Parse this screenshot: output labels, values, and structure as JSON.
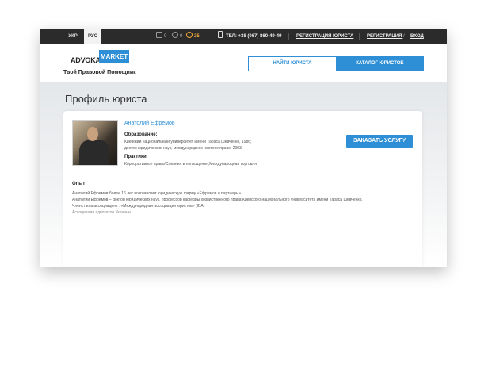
{
  "topbar": {
    "lang_ukr": "УКР",
    "lang_rus": "РУС",
    "counter_messages": "0",
    "counter_questions": "0",
    "counter_notifications": "25",
    "phone": "ТЕЛ: +38 (067) 860-49-49",
    "register_lawyer": "РЕГИСТРАЦИЯ ЮРИСТА",
    "register": "РЕГИСТРАЦИЯ",
    "slash": "/",
    "login": "ВХОД"
  },
  "header": {
    "logo_text": "ADVOKAT",
    "logo_box": "MARKET",
    "logo_tagline": "Твой Правовой Помощник",
    "btn_find": "НАЙТИ ЮРИСТА",
    "btn_catalog": "КАТАЛОГ ЮРИСТОВ"
  },
  "page": {
    "title": "Профиль юриста"
  },
  "profile": {
    "name": "Анатолий Ефремов",
    "education_label": "Образование:",
    "education_line1": "Киевский национальный университет имени Тараса Шевченко, 1986;",
    "education_line2": "доктор юридических наук, международное частное право, 2003",
    "practice_label": "Практики:",
    "practice_text": "Корпоративное право/Слияния и поглощения,Международная торговля",
    "order_button": "ЗАКАЗАТЬ УСЛУГУ",
    "experience_title": "Опыт",
    "experience_lines": [
      "Анатолий Ефремов более 16 лет возглавляет юридическую фирму «Ефремов и партнеры».",
      "Анатолий Ефремов – доктор юридических наук, профессор кафедры хозяйственного права Киевского национального университета имени Тараса Шевченко.",
      "Членство в ассоциациях :  «Международная ассоциация юристов» (IBA)",
      "Ассоциация адвокатов Украины"
    ]
  },
  "colors": {
    "accent": "#2e8fd6",
    "topbar": "#2b2b2b",
    "notification": "#f2a93b"
  }
}
